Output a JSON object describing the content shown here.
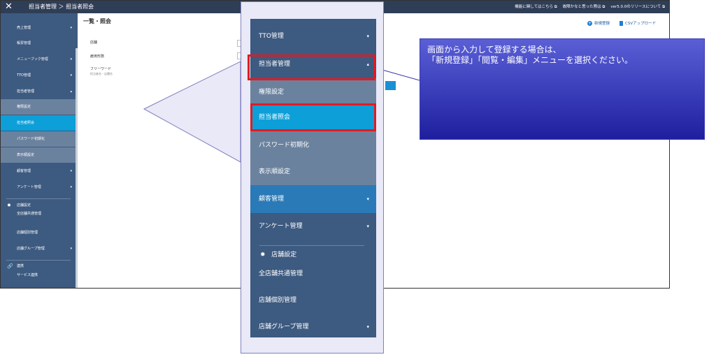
{
  "topbar": {
    "close_glyph": "✕",
    "breadcrumb": "担当者管理 ＞ 担当者照会",
    "links": [
      "機能に関してはこちら ⧉",
      "故障かなと思った際は ⧉",
      "ver5.0.0のリリースについて ⧉"
    ]
  },
  "sidebar": {
    "items": [
      {
        "label": "売上管理",
        "caret": "▾"
      },
      {
        "label": "帳票管理",
        "caret": ""
      },
      {
        "label": "メニューブック管理",
        "caret": "▾"
      },
      {
        "label": "TTO管理",
        "caret": "▾"
      },
      {
        "label": "担当者管理",
        "caret": "▴"
      },
      {
        "label": "権限設定",
        "caret": ""
      },
      {
        "label": "担当者照会",
        "caret": ""
      },
      {
        "label": "パスワード初期化",
        "caret": ""
      },
      {
        "label": "表示順設定",
        "caret": ""
      },
      {
        "label": "顧客管理",
        "caret": "▾"
      },
      {
        "label": "アンケート管理",
        "caret": "▾"
      }
    ],
    "store_heading": "店舗設定",
    "store_items": [
      {
        "label": "全店舗共通管理",
        "caret": ""
      },
      {
        "label": "店舗個別管理",
        "caret": ""
      },
      {
        "label": "店舗グループ管理",
        "caret": "▾"
      }
    ],
    "link_heading": "連携",
    "link_items": [
      {
        "label": "サービス連携"
      }
    ]
  },
  "main": {
    "title": "一覧・照会",
    "fields": [
      "店舗",
      "雇用形態",
      "フリーワード"
    ],
    "freeword_hint": "担当者名・店舗名",
    "actions": {
      "new": "新規登録",
      "csv": "CSVアップロード",
      "new_glyph": "+"
    }
  },
  "zoom_menu": {
    "items": [
      {
        "label": "TTO管理",
        "caret": "▾"
      },
      {
        "label": "担当者管理",
        "caret": "▴"
      },
      {
        "label": "権限設定",
        "caret": ""
      },
      {
        "label": "担当者照会",
        "caret": ""
      },
      {
        "label": "パスワード初期化",
        "caret": ""
      },
      {
        "label": "表示順設定",
        "caret": ""
      },
      {
        "label": "顧客管理",
        "caret": "▾"
      },
      {
        "label": "アンケート管理",
        "caret": "▾"
      }
    ],
    "store_heading": "店舗設定",
    "store_items": [
      {
        "label": "全店舗共通管理",
        "caret": ""
      },
      {
        "label": "店舗個別管理",
        "caret": ""
      },
      {
        "label": "店舗グループ管理",
        "caret": "▾"
      }
    ]
  },
  "note": {
    "line1": "画面から入力して登録する場合は、",
    "line2": "「新規登録」「閲覧・編集」メニューを選択ください。"
  },
  "colors": {
    "sidebar": "#3d5a80",
    "active": "#0d9fd8",
    "highlight": "#e01b24",
    "note": "#3a3ab0"
  }
}
